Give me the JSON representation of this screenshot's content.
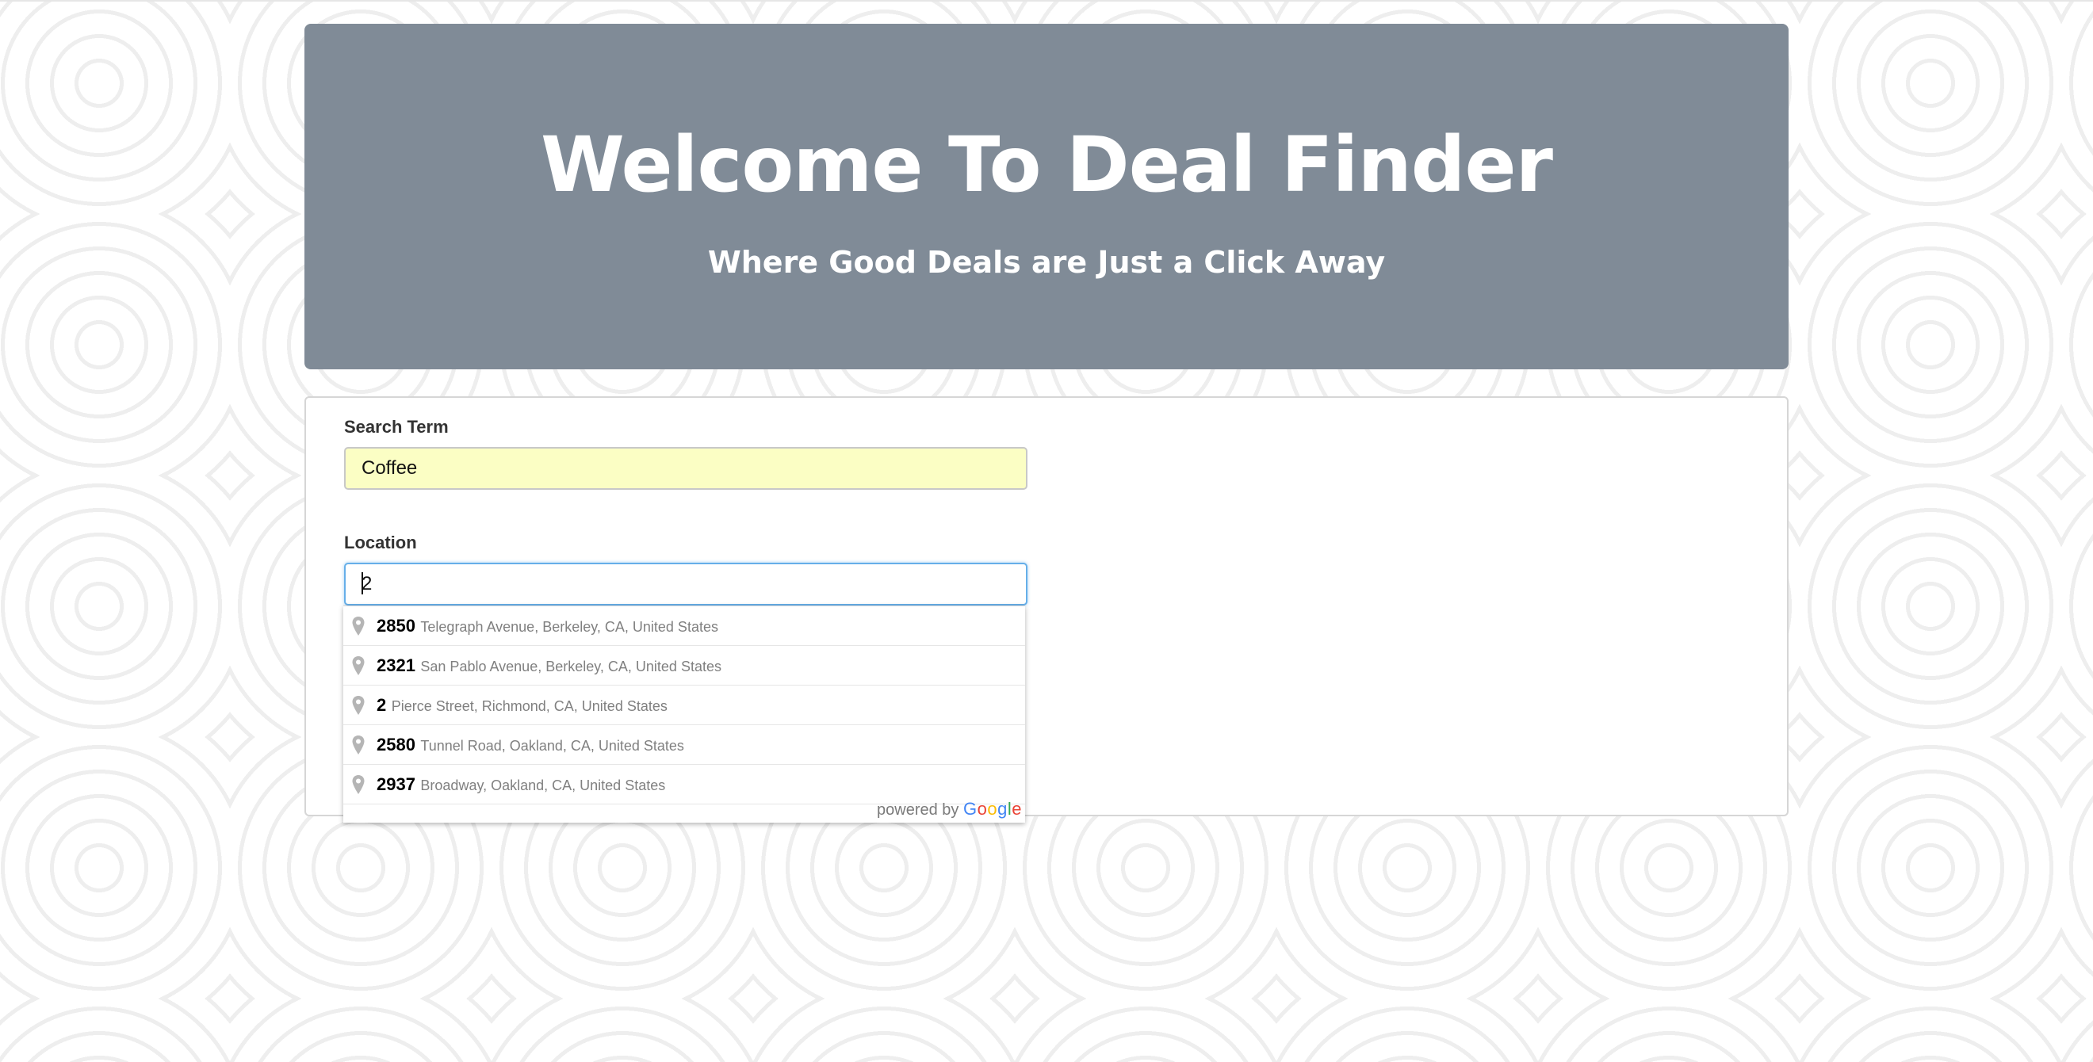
{
  "header": {
    "title": "Welcome To Deal Finder",
    "subtitle": "Where Good Deals are Just a Click Away"
  },
  "form": {
    "search_label": "Search Term",
    "search_value": "Coffee",
    "location_label": "Location",
    "location_value": "2"
  },
  "autocomplete": {
    "items": [
      {
        "match": "2850",
        "rest": "Telegraph Avenue, Berkeley, CA, United States"
      },
      {
        "match": "2321",
        "rest": "San Pablo Avenue, Berkeley, CA, United States"
      },
      {
        "match": "2",
        "rest": "Pierce Street, Richmond, CA, United States"
      },
      {
        "match": "2580",
        "rest": "Tunnel Road, Oakland, CA, United States"
      },
      {
        "match": "2937",
        "rest": "Broadway, Oakland, CA, United States"
      }
    ],
    "powered_by": "powered by",
    "google": {
      "G": "G",
      "o1": "o",
      "o2": "o",
      "g": "g",
      "l": "l",
      "e": "e"
    }
  },
  "colors": {
    "hero_bg": "#808b97",
    "search_bg": "#fbfec4",
    "focus_border": "#66afe9"
  },
  "icons": {
    "pin": "map-pin-icon"
  }
}
